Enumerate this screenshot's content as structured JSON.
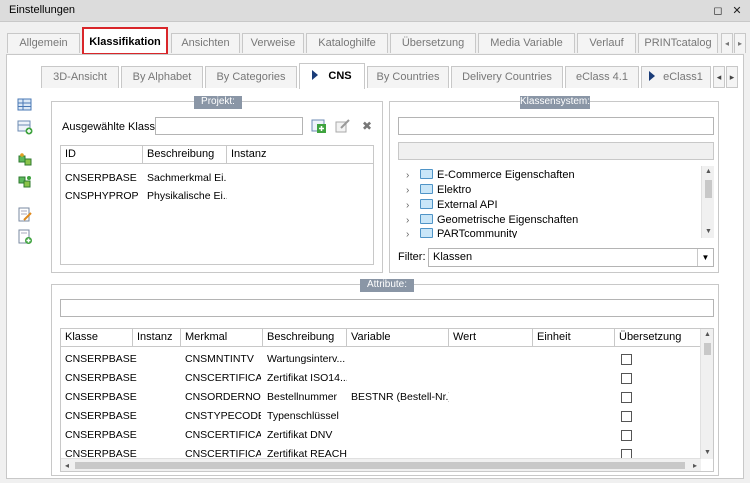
{
  "window": {
    "title": "Einstellungen",
    "restore_glyph": "◻",
    "close_glyph": "✕"
  },
  "main_tabs": [
    {
      "label": "Allgemein"
    },
    {
      "label": "Klassifikation",
      "active": true
    },
    {
      "label": "Ansichten"
    },
    {
      "label": "Verweise"
    },
    {
      "label": "Kataloghilfe"
    },
    {
      "label": "Übersetzung"
    },
    {
      "label": "Media Variable"
    },
    {
      "label": "Verlauf"
    },
    {
      "label": "PRINTcatalog"
    }
  ],
  "sub_tabs": [
    {
      "label": "3D-Ansicht"
    },
    {
      "label": "By Alphabet"
    },
    {
      "label": "By Categories"
    },
    {
      "label": "CNS",
      "active": true
    },
    {
      "label": "By Countries"
    },
    {
      "label": "Delivery Countries"
    },
    {
      "label": "eClass 4.1"
    },
    {
      "label": "eClass1"
    }
  ],
  "sub_tabs_nav": {
    "left": "◂",
    "right": "▸"
  },
  "projekt": {
    "title": "Projekt:",
    "selected_label": "Ausgewählte Klassen",
    "selected_value": "",
    "columns": [
      "ID",
      "Beschreibung",
      "Instanz"
    ],
    "rows": [
      {
        "id": "CNSERPBASE",
        "beschreibung": "Sachmerkmal Ei...",
        "instanz": ""
      },
      {
        "id": "CNSPHYPROP",
        "beschreibung": "Physikalische Ei...",
        "instanz": ""
      }
    ],
    "delete_glyph": "✖"
  },
  "klassensystem": {
    "title": "Klassensystem:",
    "search_value": "",
    "path_value": "",
    "tree": [
      "E-Commerce Eigenschaften",
      "Elektro",
      "External API",
      "Geometrische Eigenschaften",
      "PARTcommunity"
    ],
    "filter_label": "Filter:",
    "filter_value": "Klassen"
  },
  "attribute": {
    "title": "Attribute:",
    "search_value": "",
    "columns": [
      "Klasse",
      "Instanz",
      "Merkmal",
      "Beschreibung",
      "Variable",
      "Wert",
      "Einheit",
      "Übersetzung"
    ],
    "rows": [
      {
        "klasse": "CNSERPBASE",
        "instanz": "",
        "merkmal": "CNSMNTINTV",
        "beschreibung": "Wartungsinterv...",
        "variable": "",
        "wert": "",
        "einheit": ""
      },
      {
        "klasse": "CNSERPBASE",
        "instanz": "",
        "merkmal": "CNSCERTIFICA...",
        "beschreibung": "Zertifikat ISO14...",
        "variable": "",
        "wert": "",
        "einheit": ""
      },
      {
        "klasse": "CNSERPBASE",
        "instanz": "",
        "merkmal": "CNSORDERNO",
        "beschreibung": "Bestellnummer",
        "variable": "BESTNR (Bestell-Nr.)",
        "wert": "",
        "einheit": ""
      },
      {
        "klasse": "CNSERPBASE",
        "instanz": "",
        "merkmal": "CNSTYPECODE",
        "beschreibung": "Typenschlüssel",
        "variable": "",
        "wert": "",
        "einheit": ""
      },
      {
        "klasse": "CNSERPBASE",
        "instanz": "",
        "merkmal": "CNSCERTIFICA...",
        "beschreibung": "Zertifikat DNV",
        "variable": "",
        "wert": "",
        "einheit": ""
      },
      {
        "klasse": "CNSERPBASE",
        "instanz": "",
        "merkmal": "CNSCERTIFICA...",
        "beschreibung": "Zertifikat REACH",
        "variable": "",
        "wert": "",
        "einheit": ""
      }
    ]
  },
  "scroll": {
    "up": "▲",
    "down": "▼",
    "left": "◂",
    "right": "▸",
    "dd": "▼"
  },
  "tree_chevron": "›",
  "colors": {
    "active_tab_border": "#d9262a",
    "groupbox_title": "#8a96a6"
  }
}
